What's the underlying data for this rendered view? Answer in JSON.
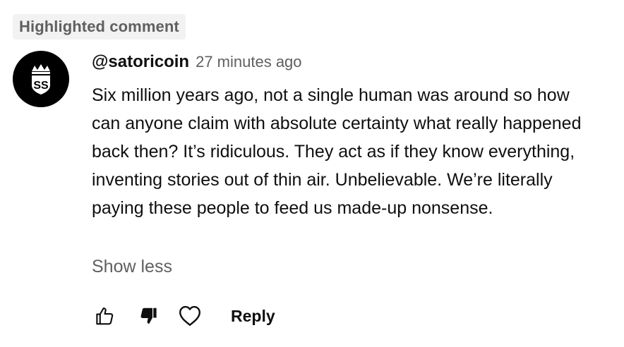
{
  "badge": {
    "label": "Highlighted comment"
  },
  "comment": {
    "avatar_icon": "crowned-ss-logo",
    "author": "@satoricoin",
    "timestamp": "27 minutes ago",
    "text": "Six million years ago, not a single human was around so how can anyone claim with absolute certainty what really happened back then? It’s ridiculous. They act as if they know everything, inventing stories out of thin air. Unbelievable. We’re literally paying these people to feed us made-up nonsense.",
    "show_less_label": "Show less"
  },
  "actions": {
    "like_icon": "thumbs-up-icon",
    "dislike_icon": "thumbs-down-filled-icon",
    "heart_icon": "heart-icon",
    "reply_label": "Reply"
  },
  "colors": {
    "primary_text": "#0f0f0f",
    "secondary_text": "#606060",
    "badge_background": "#f2f2f2",
    "avatar_background": "#000000"
  }
}
